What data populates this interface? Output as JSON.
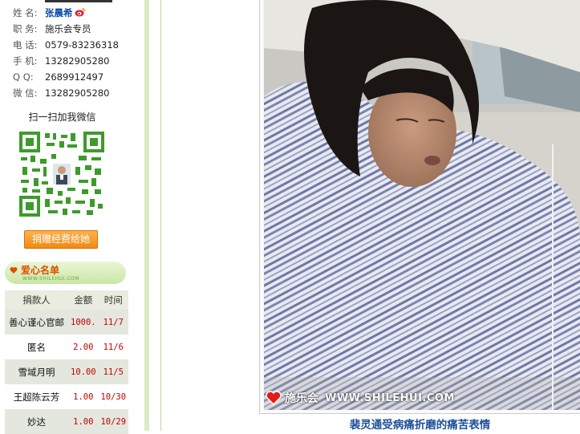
{
  "profile": {
    "name_label": "姓 名:",
    "name": "张晨希",
    "title_label": "职 务:",
    "title": "施乐会专员",
    "phone_label": "电 话:",
    "phone": "0579-83236318",
    "mobile_label": "手 机:",
    "mobile": "13282905280",
    "qq_label": "Q Q:",
    "qq": "2689912497",
    "wechat_label": "微 信:",
    "wechat": "13282905280"
  },
  "qr": {
    "title": "扫一扫加我微信"
  },
  "donate_button": "捐赠经费给她",
  "love_list": {
    "title": "爱心名单",
    "url": "WWW.SHILEHUI.COM",
    "headers": [
      "捐款人",
      "金额",
      "时间"
    ],
    "rows": [
      {
        "name": "善心谨心官邮",
        "amount": "1000.",
        "date": "11/7"
      },
      {
        "name": "匿名",
        "amount": "2.00",
        "date": "11/6"
      },
      {
        "name": "雪域月明",
        "amount": "10.00",
        "date": "11/5"
      },
      {
        "name": "王超陈云芳",
        "amount": "1.00",
        "date": "10/30"
      },
      {
        "name": "妙达",
        "amount": "1.00",
        "date": "10/29"
      }
    ]
  },
  "photo": {
    "watermark_logo": "施乐会",
    "watermark_url": "WWW.SHILEHUI.COM",
    "caption": "裴灵通受病痛折磨的痛苦表情"
  },
  "colors": {
    "accent_green": "#b9d9a0",
    "link_blue": "#1b4f99",
    "amount_red": "#c40000",
    "button_orange": "#f08a14"
  }
}
